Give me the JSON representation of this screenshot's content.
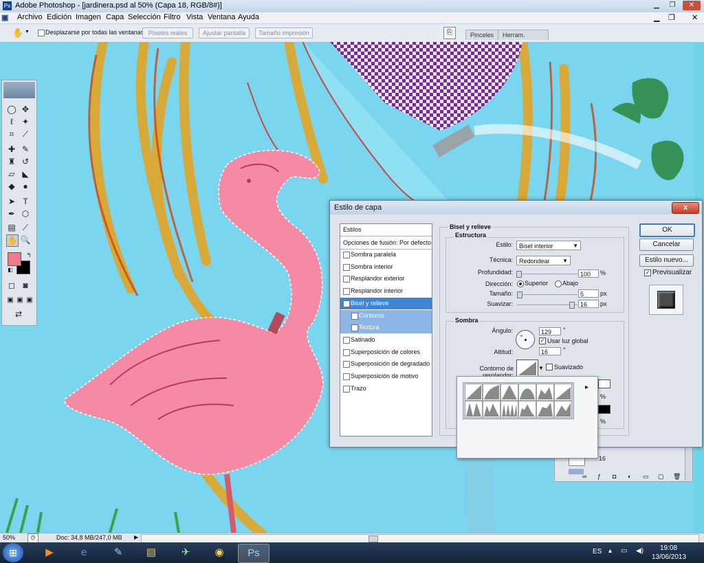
{
  "titlebar": {
    "title": "Adobe Photoshop - [jardinera.psd al 50% (Capa 18, RGB/8#)]"
  },
  "menu": [
    "Archivo",
    "Edición",
    "Imagen",
    "Capa",
    "Selección",
    "Filtro",
    "Vista",
    "Ventana",
    "Ayuda"
  ],
  "options": {
    "scroll_all_label": "Desplazarse por todas las ventanas",
    "actual_pixels": "Píxeles reales",
    "fit_screen": "Ajustar pantalla",
    "print_size": "Tamaño impresión",
    "tab_brushes": "Pinceles",
    "tab_presets": "Herram. preest."
  },
  "dialog": {
    "title": "Estilo de capa",
    "close": "x",
    "styles": [
      {
        "label": "Estilos",
        "checkbox": false,
        "checked": false,
        "selected": false,
        "sub": false
      },
      {
        "label": "Opciones de fusión: Por defecto",
        "checkbox": false,
        "checked": false,
        "selected": false,
        "sub": false
      },
      {
        "label": "Sombra paralela",
        "checkbox": true,
        "checked": false,
        "selected": false,
        "sub": false
      },
      {
        "label": "Sombra interior",
        "checkbox": true,
        "checked": false,
        "selected": false,
        "sub": false
      },
      {
        "label": "Resplandor exterior",
        "checkbox": true,
        "checked": false,
        "selected": false,
        "sub": false
      },
      {
        "label": "Resplandor interior",
        "checkbox": true,
        "checked": false,
        "selected": false,
        "sub": false
      },
      {
        "label": "Bisel y relieve",
        "checkbox": true,
        "checked": true,
        "selected": true,
        "sub": false
      },
      {
        "label": "Contorno",
        "checkbox": true,
        "checked": false,
        "selected": true,
        "sub": true
      },
      {
        "label": "Textura",
        "checkbox": true,
        "checked": false,
        "selected": true,
        "sub": true
      },
      {
        "label": "Satinado",
        "checkbox": true,
        "checked": false,
        "selected": false,
        "sub": false
      },
      {
        "label": "Superposición de colores",
        "checkbox": true,
        "checked": false,
        "selected": false,
        "sub": false
      },
      {
        "label": "Superposición de degradado",
        "checkbox": true,
        "checked": false,
        "selected": false,
        "sub": false
      },
      {
        "label": "Superposición de motivo",
        "checkbox": true,
        "checked": false,
        "selected": false,
        "sub": false
      },
      {
        "label": "Trazo",
        "checkbox": true,
        "checked": false,
        "selected": false,
        "sub": false
      }
    ],
    "section_title": "Bisel y relieve",
    "structure": {
      "title": "Estructura",
      "style_label": "Estilo:",
      "style_value": "Bisel interior",
      "technique_label": "Técnica:",
      "technique_value": "Redondear",
      "depth_label": "Profundidad:",
      "depth_value": "100",
      "depth_unit": "%",
      "direction_label": "Dirección:",
      "direction_up": "Superior",
      "direction_down": "Abajo",
      "size_label": "Tamaño:",
      "size_value": "5",
      "size_unit": "px",
      "soften_label": "Suavizar:",
      "soften_value": "16",
      "soften_unit": "px"
    },
    "shading": {
      "title": "Sombra",
      "angle_label": "Ángulo:",
      "angle_value": "129",
      "angle_unit": "°",
      "global_light": "Usar luz global",
      "altitude_label": "Altitud:",
      "altitude_value": "16",
      "altitude_unit": "°",
      "gloss_label": "Contorno de resplandor:",
      "antialiased": "Suavizado",
      "pct1": "%",
      "pct2": "%"
    },
    "buttons": {
      "ok": "OK",
      "cancel": "Cancelar",
      "new_style": "Estilo nuevo...",
      "preview": "Previsualizar"
    }
  },
  "layers": {
    "opacity_value": "16"
  },
  "status": {
    "zoom": "50%",
    "doc": "Doc: 34,8 MB/247,0 MB"
  },
  "taskbar": {
    "lang": "ES",
    "time": "19:08",
    "date": "13/06/2013"
  },
  "colors": {
    "foreground": "#f07a8a",
    "background": "#000000",
    "selection": "#3d86d6",
    "flamingo": "#f48aa3"
  }
}
